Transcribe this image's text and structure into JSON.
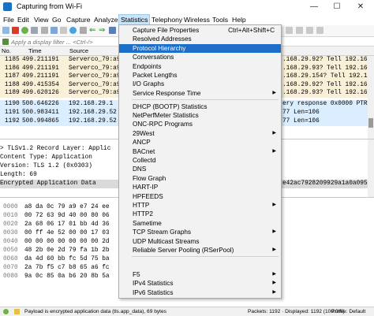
{
  "window": {
    "title": "Capturing from Wi-Fi",
    "minimize": "—",
    "maximize": "☐",
    "close": "✕"
  },
  "menubar": [
    "File",
    "Edit",
    "View",
    "Go",
    "Capture",
    "Analyze",
    "Statistics",
    "Telephony",
    "Wireless",
    "Tools",
    "Help"
  ],
  "filter": {
    "placeholder": "Apply a display filter ... <Ctrl-/>"
  },
  "packet_list": {
    "columns": [
      "No.",
      "Time",
      "Source"
    ],
    "rows": [
      {
        "no": "1185",
        "time": "499.211191",
        "source": "Servercо_79:a9:e7",
        "info": ".168.29.92? Tell 192.168.2"
      },
      {
        "no": "1186",
        "time": "499.211191",
        "source": "Servercо_79:a9:e7",
        "info": ".168.29.93? Tell 192.168.2"
      },
      {
        "no": "1187",
        "time": "499.211191",
        "source": "Servercо_79:a9:e7",
        "info": ".168.29.154? Tell 192.168."
      },
      {
        "no": "1188",
        "time": "499.415354",
        "source": "Servercо_79:a9:e7",
        "info": ".168.29.92? Tell 192.168.2"
      },
      {
        "no": "1189",
        "time": "499.620126",
        "source": "Servercо_79:a9:e7",
        "info": ".168.29.93? Tell 192.168.2"
      },
      {
        "no": "1190",
        "time": "500.646226",
        "source": "192.168.29.1",
        "info": "ery response 0x0000 PTR"
      },
      {
        "no": "1191",
        "time": "500.983411",
        "source": "192.168.29.52",
        "info": "77 Len=106"
      },
      {
        "no": "1192",
        "time": "500.994865",
        "source": "192.168.29.52",
        "info": "77 Len=106"
      }
    ]
  },
  "details": [
    "> TLSv1.2 Record Layer: Applic",
    "    Content Type: Application",
    "    Version: TLS 1.2 (0x0303)",
    "    Length: 69",
    "    Encrypted Application Data"
  ],
  "details_selected_tail": "e42ac7928209929a1a0a0958",
  "hex": [
    {
      "offset": "0000",
      "bytes": "a8 da 0c 79 a9 e7 24 ee"
    },
    {
      "offset": "0010",
      "bytes": "00 72 63 9d 40 00 80 06"
    },
    {
      "offset": "0020",
      "bytes": "2a 68 06 17 01 bb 4d 36"
    },
    {
      "offset": "0030",
      "bytes": "00 ff 4e 52 00 00 17 03"
    },
    {
      "offset": "0040",
      "bytes": "00 00 00 00 00 00 00 2d"
    },
    {
      "offset": "0050",
      "bytes": "48 2b 0e 2d 79 fa 1b 2b"
    },
    {
      "offset": "0060",
      "bytes": "da 4d 60 bb fc 5d 75 ba"
    },
    {
      "offset": "0070",
      "bytes": "2a 7b f5 c7 b8 65 a6 fc"
    },
    {
      "offset": "0080",
      "bytes": "9a 0c 85 0a b6 20 8b 5a"
    }
  ],
  "statusbar": {
    "payload": "Payload is encrypted application data (tls.app_data), 69 bytes",
    "packets": "Packets: 1192 · Displayed: 1192 (100.0%)",
    "profile": "Profile: Default"
  },
  "statistics_menu": {
    "items": [
      {
        "label": "Capture File Properties",
        "shortcut": "Ctrl+Alt+Shift+C",
        "submenu": false
      },
      {
        "label": "Resolved Addresses",
        "shortcut": "",
        "submenu": false
      },
      {
        "label": "Protocol Hierarchy",
        "shortcut": "",
        "submenu": false,
        "highlighted": true
      },
      {
        "label": "Conversations",
        "shortcut": "",
        "submenu": false
      },
      {
        "label": "Endpoints",
        "shortcut": "",
        "submenu": false
      },
      {
        "label": "Packet Lengths",
        "shortcut": "",
        "submenu": false
      },
      {
        "label": "I/O Graphs",
        "shortcut": "",
        "submenu": false
      },
      {
        "label": "Service Response Time",
        "shortcut": "",
        "submenu": true
      },
      {
        "label": "DHCP (BOOTP) Statistics",
        "shortcut": "",
        "submenu": false
      },
      {
        "label": "NetPerfMeter Statistics",
        "shortcut": "",
        "submenu": false
      },
      {
        "label": "ONC-RPC Programs",
        "shortcut": "",
        "submenu": false
      },
      {
        "label": "29West",
        "shortcut": "",
        "submenu": true
      },
      {
        "label": "ANCP",
        "shortcut": "",
        "submenu": false
      },
      {
        "label": "BACnet",
        "shortcut": "",
        "submenu": true
      },
      {
        "label": "Collectd",
        "shortcut": "",
        "submenu": false
      },
      {
        "label": "DNS",
        "shortcut": "",
        "submenu": false
      },
      {
        "label": "Flow Graph",
        "shortcut": "",
        "submenu": false
      },
      {
        "label": "HART-IP",
        "shortcut": "",
        "submenu": false
      },
      {
        "label": "HPFEEDS",
        "shortcut": "",
        "submenu": false
      },
      {
        "label": "HTTP",
        "shortcut": "",
        "submenu": true
      },
      {
        "label": "HTTP2",
        "shortcut": "",
        "submenu": false
      },
      {
        "label": "Sametime",
        "shortcut": "",
        "submenu": false
      },
      {
        "label": "TCP Stream Graphs",
        "shortcut": "",
        "submenu": true
      },
      {
        "label": "UDP Multicast Streams",
        "shortcut": "",
        "submenu": false
      },
      {
        "label": "Reliable Server Pooling (RSerPool)",
        "shortcut": "",
        "submenu": true
      },
      {
        "label": "F5",
        "shortcut": "",
        "submenu": true
      },
      {
        "label": "IPv4 Statistics",
        "shortcut": "",
        "submenu": true
      },
      {
        "label": "IPv6 Statistics",
        "shortcut": "",
        "submenu": true
      }
    ]
  },
  "colors": {
    "row_arp": "#faf0d7",
    "row_udp": "#daeeff",
    "menu_highlight": "#1c6ec9",
    "stop_button": "#d83b2a",
    "start_fin": "#1673c5"
  }
}
